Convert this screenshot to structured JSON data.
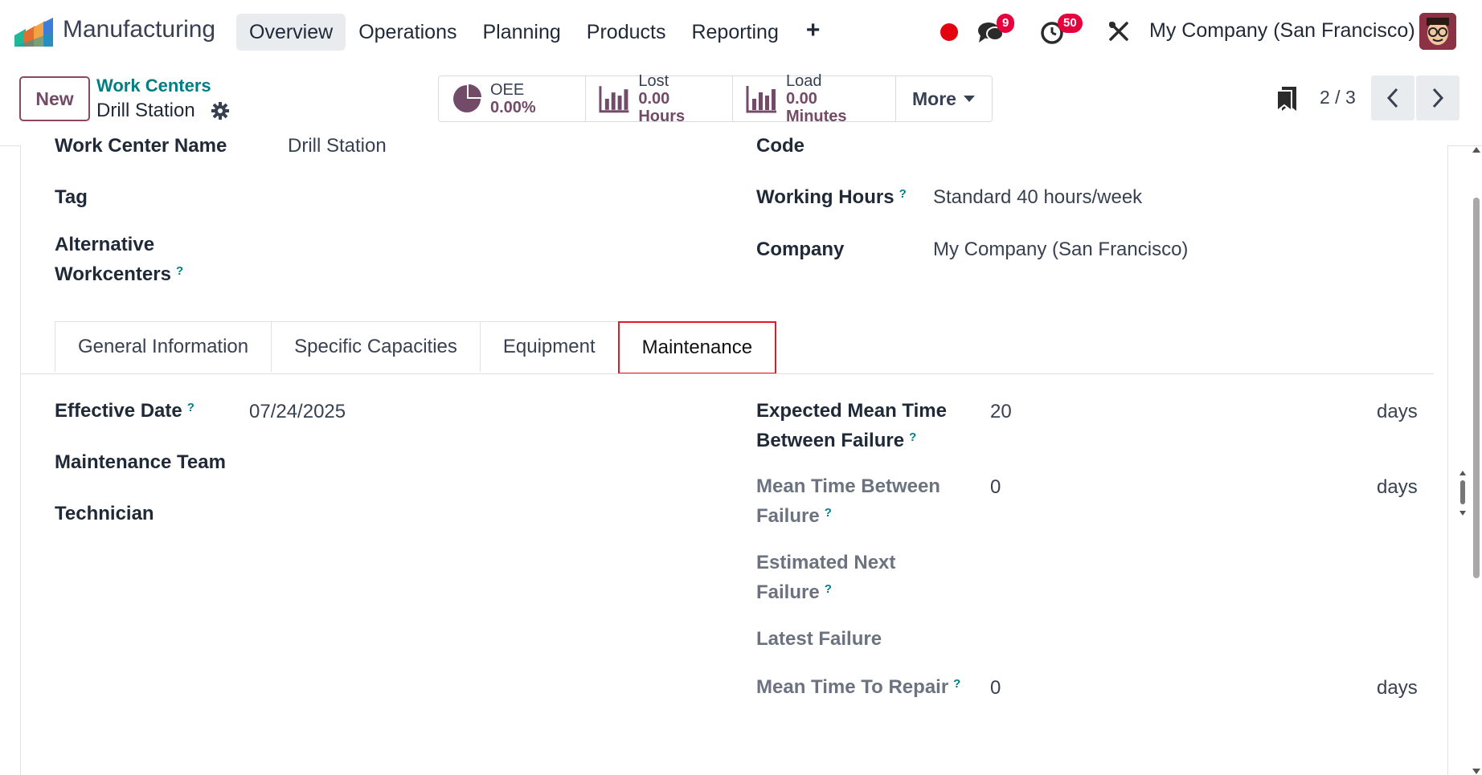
{
  "navbar": {
    "app_name": "Manufacturing",
    "menu": [
      "Overview",
      "Operations",
      "Planning",
      "Products",
      "Reporting"
    ],
    "active_menu": "Overview",
    "plus_icon": "+",
    "messages_badge": "9",
    "activities_badge": "50",
    "company": "My Company (San Francisco)",
    "accent_color": "#714b67"
  },
  "control": {
    "new_label": "New",
    "breadcrumb_parent": "Work Centers",
    "breadcrumb_current": "Drill Station",
    "stats": [
      {
        "label": "OEE",
        "value": "0.00%",
        "icon": "pie-chart-icon"
      },
      {
        "label": "Lost",
        "value": "0.00 Hours",
        "icon": "bar-chart-icon"
      },
      {
        "label": "Load",
        "value": "0.00 Minutes",
        "icon": "bar-chart-icon"
      }
    ],
    "more_label": "More",
    "pager": "2 / 3"
  },
  "form": {
    "top_left_label": "Work Center Name",
    "top_left_value": "Drill Station",
    "top_right_label": "Code",
    "tag_label": "Tag",
    "alt_label_line1": "Alternative",
    "alt_label_line2": "Workcenters",
    "working_hours_label": "Working Hours",
    "working_hours_value": "Standard 40 hours/week",
    "company_label": "Company",
    "company_value": "My Company (San Francisco)",
    "help_mark": "?"
  },
  "tabs": [
    "General Information",
    "Specific Capacities",
    "Equipment",
    "Maintenance"
  ],
  "active_tab": "Maintenance",
  "maintenance": {
    "effective_date_label": "Effective Date",
    "effective_date_value": "07/24/2025",
    "maintenance_team_label": "Maintenance Team",
    "technician_label": "Technician",
    "expected_mtbf_label_1": "Expected Mean Time",
    "expected_mtbf_label_2": "Between Failure",
    "expected_mtbf_value": "20",
    "mtbf_label_1": "Mean Time Between",
    "mtbf_label_2": "Failure",
    "mtbf_value": "0",
    "estimated_next_label_1": "Estimated Next",
    "estimated_next_label_2": "Failure",
    "latest_failure_label": "Latest Failure",
    "mttr_label": "Mean Time To Repair",
    "mttr_value": "0",
    "unit_days": "days"
  }
}
